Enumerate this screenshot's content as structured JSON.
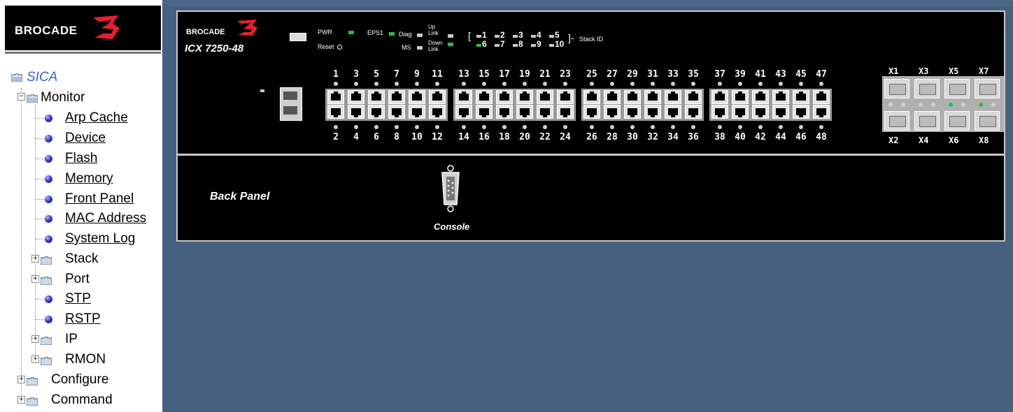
{
  "sidebar": {
    "brand": "BROCADE",
    "tree": {
      "root": "SICA",
      "monitor": "Monitor",
      "monitor_items": [
        "Arp Cache",
        "Device",
        "Flash",
        "Memory",
        "Front Panel",
        "MAC Address",
        "System Log"
      ],
      "stack": "Stack",
      "port": "Port",
      "stp": "STP",
      "rstp": "RSTP",
      "ip": "IP",
      "rmon": "RMON",
      "configure": "Configure",
      "command": "Command"
    }
  },
  "front_panel": {
    "brand": "BROCADE",
    "model": "ICX 7250-48",
    "pwr": "PWR",
    "reset": "Reset",
    "eps1": "EPS1",
    "diag": "Diag",
    "ms": "MS",
    "up_link": "Up Link",
    "down_link": "Down Link",
    "stack_id_label": "Stack ID",
    "stack_top": [
      "1",
      "2",
      "3",
      "4",
      "5"
    ],
    "stack_bottom": [
      "6",
      "7",
      "8",
      "9",
      "10"
    ],
    "ports_top": [
      "1",
      "3",
      "5",
      "7",
      "9",
      "11",
      "13",
      "15",
      "17",
      "19",
      "21",
      "23",
      "25",
      "27",
      "29",
      "31",
      "33",
      "35",
      "37",
      "39",
      "41",
      "43",
      "45",
      "47"
    ],
    "ports_bottom": [
      "2",
      "4",
      "6",
      "8",
      "10",
      "12",
      "14",
      "16",
      "18",
      "20",
      "22",
      "24",
      "26",
      "28",
      "30",
      "32",
      "34",
      "36",
      "38",
      "40",
      "42",
      "44",
      "46",
      "48"
    ],
    "sfp_top": [
      "X1",
      "X3",
      "X5",
      "X7"
    ],
    "sfp_bottom": [
      "X2",
      "X4",
      "X6",
      "X8"
    ],
    "sfp_link_up": [
      "X5",
      "X7"
    ],
    "colors": {
      "led_on": "#22c04a",
      "led_off": "#c8c8c8",
      "background": "#46607f"
    }
  },
  "back_panel": {
    "title": "Back Panel",
    "console": "Console"
  }
}
